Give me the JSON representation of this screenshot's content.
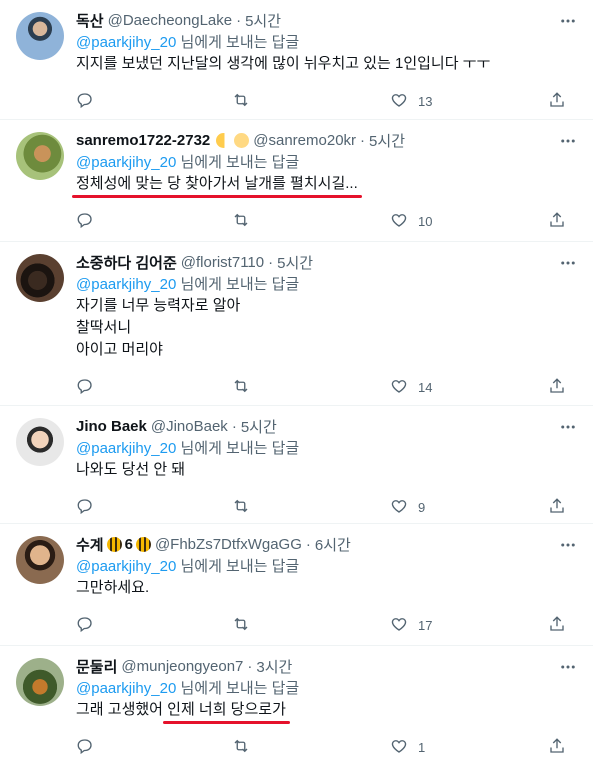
{
  "reply_to_prefix": "",
  "reply_to_handle": "@paarkjihy_20",
  "reply_to_suffix": "님에게 보내는 답글",
  "colors": {
    "link": "#1d9bf0",
    "muted": "#536471",
    "text": "#0f1419",
    "highlight": "#e5112b"
  },
  "tweets": [
    {
      "name": "독산",
      "handle": "@DaecheongLake",
      "dot": "·",
      "time": "5시간",
      "lines": [
        "지지를 보냈던 지난달의 생각에 많이 뉘우치고 있는 1인입니다 ㅜㅜ"
      ],
      "likes": "13"
    },
    {
      "name": "sanremo1722-2732",
      "handle": "@sanremo20kr",
      "dot": "·",
      "time": "5시간",
      "lines": [
        "정체성에 맞는 당 찾아가서 날개를 펼치시길..."
      ],
      "likes": "10"
    },
    {
      "name": "소중하다 김어준",
      "handle": "@florist7110",
      "dot": "·",
      "time": "5시간",
      "lines": [
        "자기를 너무 능력자로 알아",
        "찰딱서니",
        "아이고 머리야"
      ],
      "likes": "14"
    },
    {
      "name": "Jino Baek",
      "handle": "@JinoBaek",
      "dot": "·",
      "time": "5시간",
      "lines": [
        "나와도 당선 안 돼"
      ],
      "likes": "9"
    },
    {
      "name": "수계",
      "name_suffix": "6",
      "handle": "@FhbZs7DtfxWgaGG",
      "dot": "·",
      "time": "6시간",
      "lines": [
        "그만하세요."
      ],
      "likes": "17"
    },
    {
      "name": "문둘리",
      "handle": "@munjeongyeon7",
      "dot": "·",
      "time": "3시간",
      "line_prefix": "그래 고생했어 ",
      "line_highlight": "인제 너희 당으로가",
      "likes": "1"
    }
  ],
  "icons": [
    "reply-icon",
    "retweet-icon",
    "like-icon",
    "share-icon",
    "more-icon"
  ]
}
